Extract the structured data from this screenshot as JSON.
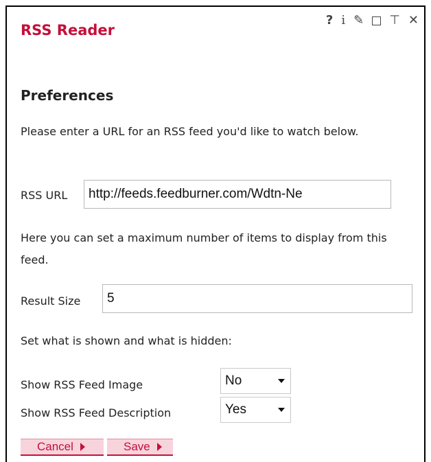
{
  "gadget": {
    "title": "RSS Reader",
    "header_icons": [
      "help-icon",
      "info-icon",
      "edit-icon",
      "maximize-icon",
      "minimize-icon",
      "close-icon"
    ],
    "help_glyph": "?",
    "info_glyph": "i",
    "edit_glyph": "✎",
    "minimize_glyph": "⊤",
    "close_glyph": "✕"
  },
  "preferences": {
    "heading": "Preferences",
    "url_instructions": "Please enter a URL for an RSS feed you'd like to watch below.",
    "rss_url_label": "RSS URL",
    "rss_url_value": "http://feeds.feedburner.com/Wdtn-Ne",
    "result_instructions": "Here you can set a maximum number of items to display from this feed.",
    "result_size_label": "Result Size",
    "result_size_value": "5",
    "visibility_instructions": "Set what is shown and what is hidden:",
    "show_image_label": "Show RSS Feed Image",
    "show_image_value": "No",
    "show_description_label": "Show RSS Feed Description",
    "show_description_value": "Yes"
  },
  "buttons": {
    "cancel_label": "Cancel",
    "save_label": "Save"
  },
  "colors": {
    "accent": "#c4103a",
    "button_bg": "#f7d4dc",
    "border": "#000000"
  }
}
